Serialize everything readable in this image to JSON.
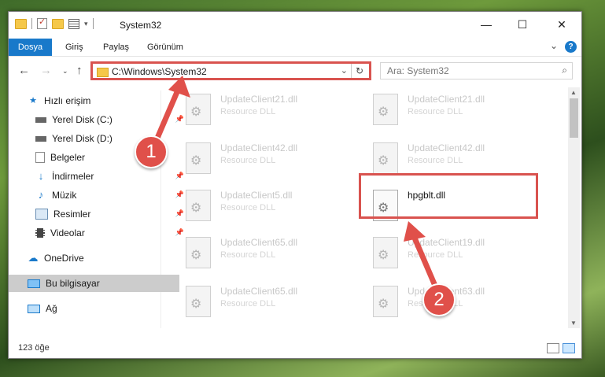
{
  "window": {
    "title": "System32",
    "quick_access": [
      "folder-icon",
      "properties-icon",
      "new-folder-icon",
      "customize-icon"
    ]
  },
  "ribbon": {
    "tabs": [
      "Dosya",
      "Giriş",
      "Paylaş",
      "Görünüm"
    ],
    "help": "?"
  },
  "nav": {
    "address": "C:\\Windows\\System32",
    "search_placeholder": "Ara: System32"
  },
  "sidebar": {
    "items": [
      {
        "label": "Hızlı erişim",
        "icon": "star-icon"
      },
      {
        "label": "Yerel Disk (C:)",
        "icon": "drive-icon",
        "pinned": true
      },
      {
        "label": "Yerel Disk (D:)",
        "icon": "drive-icon"
      },
      {
        "label": "Belgeler",
        "icon": "documents-icon"
      },
      {
        "label": "İndirmeler",
        "icon": "download-icon",
        "pinned": true
      },
      {
        "label": "Müzik",
        "icon": "music-icon",
        "pinned": true
      },
      {
        "label": "Resimler",
        "icon": "pictures-icon",
        "pinned": true
      },
      {
        "label": "Videolar",
        "icon": "videos-icon",
        "pinned": true
      },
      {
        "label": "OneDrive",
        "icon": "cloud-icon"
      },
      {
        "label": "Bu bilgisayar",
        "icon": "computer-icon",
        "selected": true
      },
      {
        "label": "Ağ",
        "icon": "network-icon"
      }
    ]
  },
  "files": [
    {
      "name": "UpdateClient21.dll",
      "type": "Resource DLL"
    },
    {
      "name": "UpdateClient21.dll",
      "type": "Resource DLL"
    },
    {
      "name": "UpdateClient42.dll",
      "type": "Resource DLL"
    },
    {
      "name": "UpdateClient42.dll",
      "type": "Resource DLL"
    },
    {
      "name": "UpdateClient5.dll",
      "type": "Resource DLL"
    },
    {
      "name": "hpgblt.dll",
      "type": ""
    },
    {
      "name": "UpdateClient65.dll",
      "type": "Resource DLL"
    },
    {
      "name": "UpdateClient19.dll",
      "type": "Resource DLL"
    },
    {
      "name": "UpdateClient65.dll",
      "type": "Resource DLL"
    },
    {
      "name": "UpdateClient63.dll",
      "type": "Resource DLL"
    }
  ],
  "status": {
    "item_count": "123 öğe"
  },
  "annotations": {
    "badge1": "1",
    "badge2": "2",
    "color": "#e0504a"
  }
}
